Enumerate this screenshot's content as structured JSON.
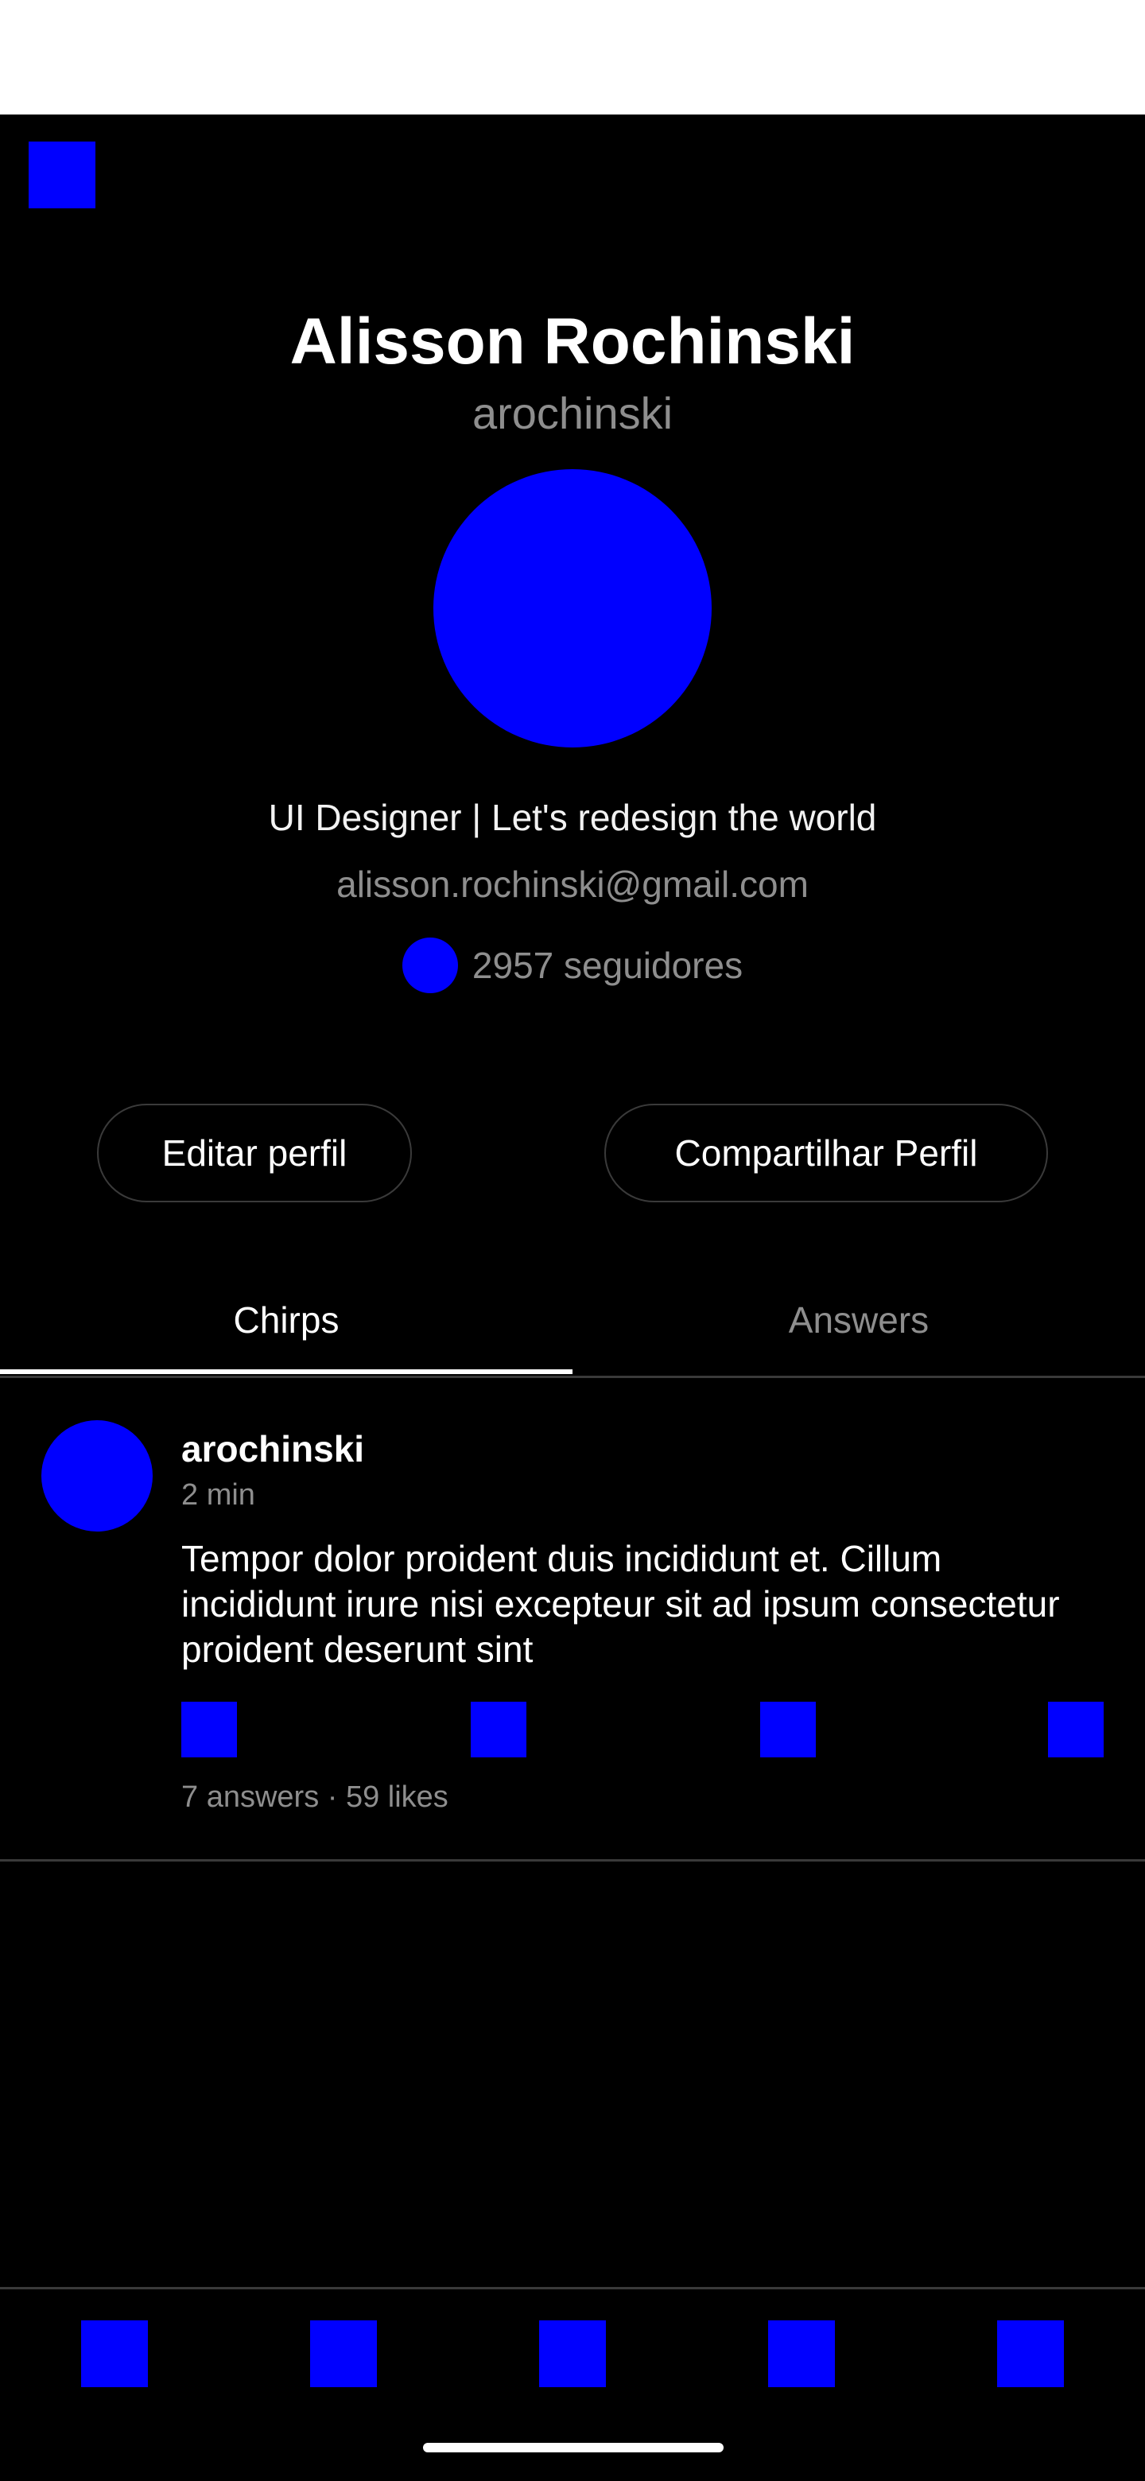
{
  "profile": {
    "name": "Alisson Rochinski",
    "handle": "arochinski",
    "bio": "UI Designer | Let's redesign the world",
    "email": "alisson.rochinski@gmail.com",
    "followers": "2957 seguidores"
  },
  "buttons": {
    "edit": "Editar perfil",
    "share": "Compartilhar Perfil"
  },
  "tabs": [
    {
      "label": "Chirps",
      "active": true
    },
    {
      "label": "Answers",
      "active": false
    }
  ],
  "posts": [
    {
      "user": "arochinski",
      "time": "2 min",
      "text": "Tempor dolor proident duis incididunt et. Cillum incididunt irure nisi excepteur sit ad ipsum consectetur proident deserunt sint",
      "stats": "7 answers · 59 likes",
      "actions": [
        "reply-icon",
        "rechirp-icon",
        "like-icon",
        "share-icon"
      ]
    }
  ],
  "nav": [
    "home-icon",
    "search-icon",
    "compose-icon",
    "notifications-icon",
    "profile-icon"
  ],
  "colors": {
    "background": "#000000",
    "placeholder": "#0000ff",
    "muted_text": "#8e8e8e",
    "divider": "#3a3a3a"
  }
}
